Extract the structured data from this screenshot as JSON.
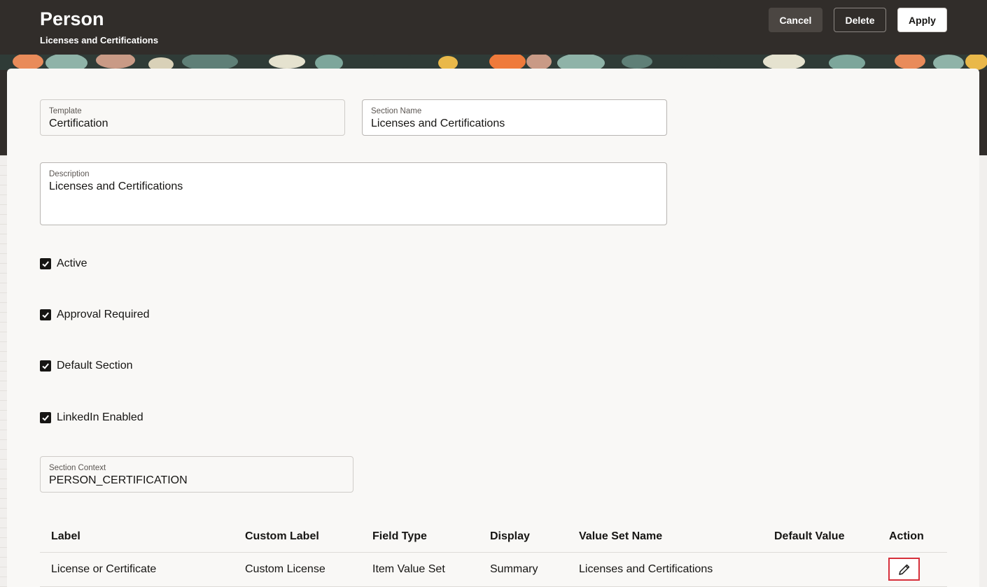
{
  "header": {
    "title": "Person",
    "subtitle": "Licenses and Certifications",
    "cancel_label": "Cancel",
    "delete_label": "Delete",
    "apply_label": "Apply"
  },
  "form": {
    "template": {
      "label": "Template",
      "value": "Certification"
    },
    "section_name": {
      "label": "Section Name",
      "value": "Licenses and Certifications"
    },
    "description": {
      "label": "Description",
      "value": "Licenses and Certifications"
    },
    "checkboxes": [
      {
        "label": "Active",
        "checked": true
      },
      {
        "label": "Approval Required",
        "checked": true
      },
      {
        "label": "Default Section",
        "checked": true
      },
      {
        "label": "LinkedIn Enabled",
        "checked": true
      }
    ],
    "section_context": {
      "label": "Section Context",
      "value": "PERSON_CERTIFICATION"
    }
  },
  "table": {
    "columns": [
      "Label",
      "Custom Label",
      "Field Type",
      "Display",
      "Value Set Name",
      "Default Value",
      "Action"
    ],
    "rows": [
      {
        "label": "License or Certificate",
        "custom_label": "Custom License",
        "field_type": "Item Value Set",
        "display": "Summary",
        "value_set_name": "Licenses and Certifications",
        "default_value": "",
        "action": "edit-icon"
      }
    ]
  },
  "colors": {
    "header_bg": "#312d2a",
    "panel_bg": "#f9f8f6",
    "highlight": "#d6303b"
  }
}
